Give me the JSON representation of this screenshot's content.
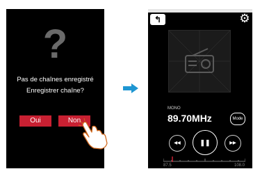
{
  "dialog": {
    "question_mark": "?",
    "message": "Pas de chaînes enregistré",
    "prompt": "Enregistrer chaîne?",
    "yes_label": "Oui",
    "no_label": "Non"
  },
  "radio": {
    "back_glyph": "↰",
    "settings_glyph": "⚙",
    "audio_mode": "MONO",
    "frequency": "89.70MHz",
    "mode_label": "Mode",
    "prev_glyph": "◀◀",
    "play_pause_glyph": "❚❚",
    "next_glyph": "▶▶",
    "scale_min": "87.5",
    "scale_max": "108.0"
  },
  "colors": {
    "accent_red": "#c82032",
    "arrow_blue": "#1e96d2",
    "screen_bg": "#000000"
  },
  "icons": [
    "question-mark-icon",
    "back-icon",
    "gear-icon",
    "radio-icon",
    "previous-icon",
    "pause-icon",
    "next-icon",
    "arrow-right-icon",
    "hand-pointer-icon"
  ]
}
